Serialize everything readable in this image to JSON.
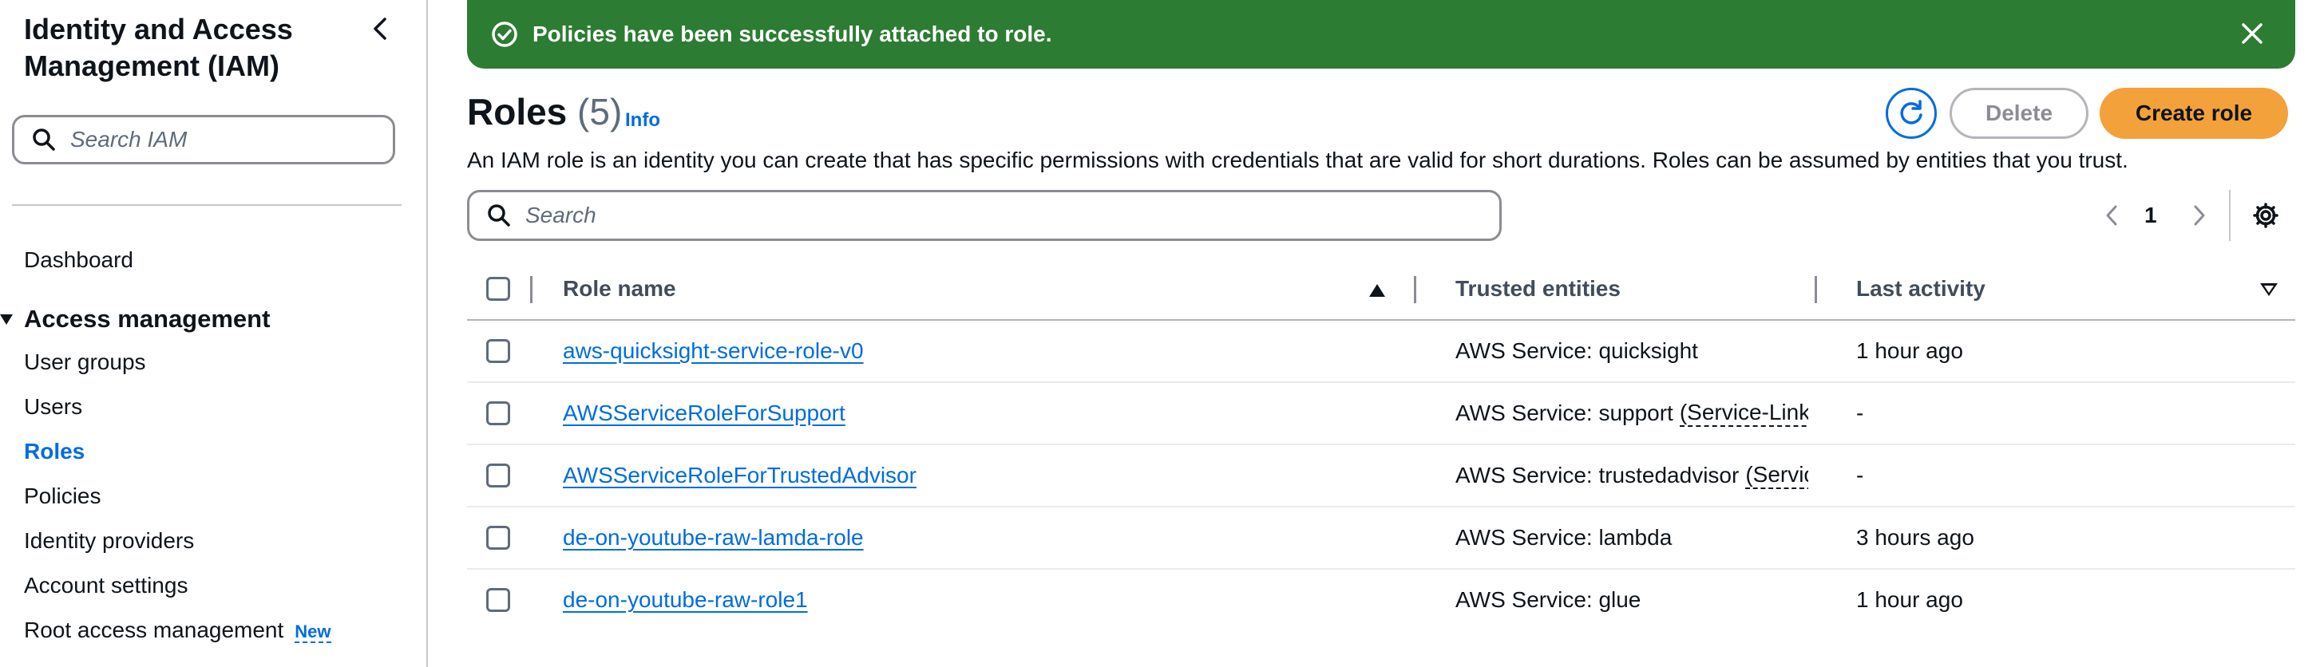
{
  "sidebar": {
    "title": "Identity and Access Management (IAM)",
    "search_placeholder": "Search IAM",
    "dashboard": "Dashboard",
    "section": "Access management",
    "items": [
      {
        "label": "User groups"
      },
      {
        "label": "Users"
      },
      {
        "label": "Roles"
      },
      {
        "label": "Policies"
      },
      {
        "label": "Identity providers"
      },
      {
        "label": "Account settings"
      },
      {
        "label": "Root access management"
      }
    ],
    "new_badge": "New",
    "active_item": "Roles"
  },
  "flash": {
    "message": "Policies have been successfully attached to role.",
    "color": "#2d7c33"
  },
  "header": {
    "title": "Roles",
    "count": "(5)",
    "info": "Info",
    "description": "An IAM role is an identity you can create that has specific permissions with credentials that are valid for short durations. Roles can be assumed by entities that you trust.",
    "delete_label": "Delete",
    "create_label": "Create role",
    "accent": "#006ce0",
    "primary_button_color": "#f3a13a"
  },
  "table": {
    "search_placeholder": "Search",
    "page": "1",
    "columns": {
      "role_name": "Role name",
      "trusted_entities": "Trusted entities",
      "last_activity": "Last activity"
    },
    "rows": [
      {
        "name": "aws-quicksight-service-role-v0",
        "trusted": "AWS Service: quicksight",
        "trusted_extra": "",
        "activity": "1 hour ago"
      },
      {
        "name": "AWSServiceRoleForSupport",
        "trusted": "AWS Service: support",
        "trusted_extra": "(Service-Linke",
        "activity": "-"
      },
      {
        "name": "AWSServiceRoleForTrustedAdvisor",
        "trusted": "AWS Service: trustedadvisor",
        "trusted_extra": "(Service",
        "activity": "-"
      },
      {
        "name": "de-on-youtube-raw-lamda-role",
        "trusted": "AWS Service: lambda",
        "trusted_extra": "",
        "activity": "3 hours ago"
      },
      {
        "name": "de-on-youtube-raw-role1",
        "trusted": "AWS Service: glue",
        "trusted_extra": "",
        "activity": "1 hour ago"
      }
    ]
  }
}
